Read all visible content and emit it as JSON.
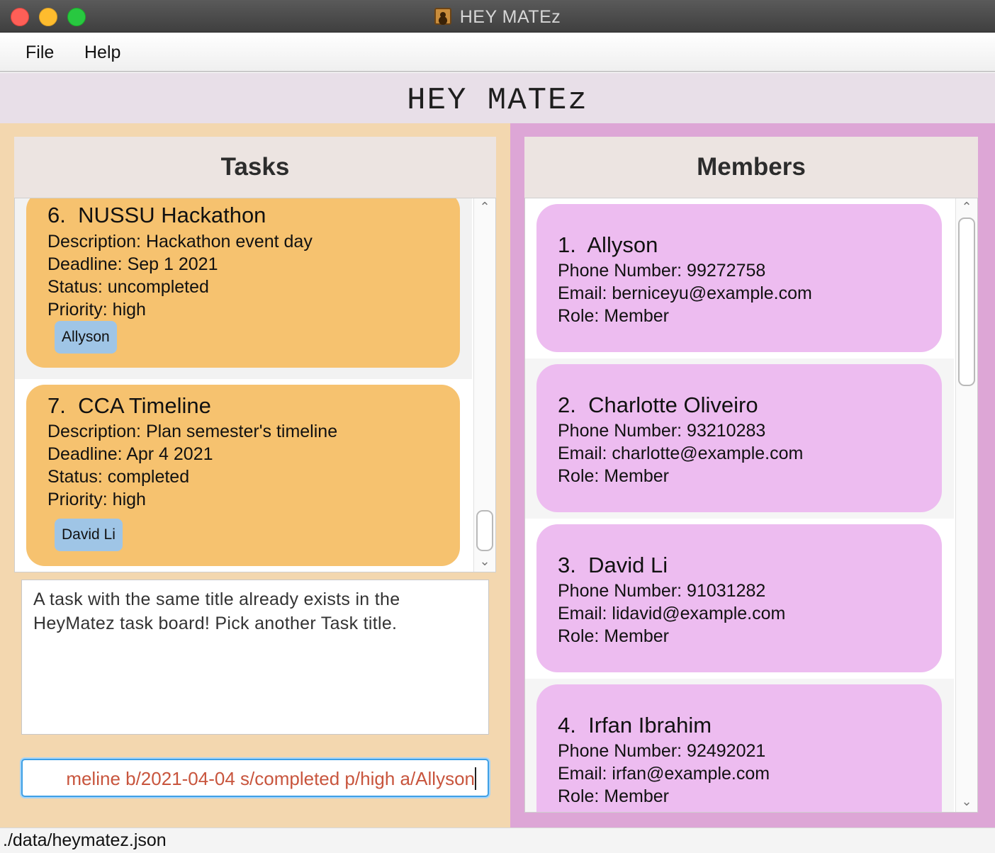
{
  "window": {
    "title": "HEY MATEz"
  },
  "menu": {
    "file": "File",
    "help": "Help"
  },
  "app": {
    "header_title": "HEY MATEz"
  },
  "tasks": {
    "header": "Tasks",
    "items": [
      {
        "index": "6.",
        "title": "NUSSU Hackathon",
        "description": "Description: Hackathon event day",
        "deadline": "Deadline: Sep 1 2021",
        "status": "Status: uncompleted",
        "priority": "Priority: high",
        "assignee": "Allyson"
      },
      {
        "index": "7.",
        "title": "CCA Timeline",
        "description": "Description: Plan semester's timeline",
        "deadline": "Deadline: Apr 4 2021",
        "status": "Status: completed",
        "priority": "Priority: high",
        "assignee": "David Li"
      }
    ]
  },
  "result": {
    "line1": "A task with the same title already exists in the",
    "line2": "HeyMatez task board! Pick another Task title."
  },
  "command": {
    "value": "meline b/2021-04-04 s/completed p/high a/Allyson"
  },
  "members": {
    "header": "Members",
    "items": [
      {
        "index": "1.",
        "name": "Allyson",
        "phone": "Phone Number: 99272758",
        "email": "Email: berniceyu@example.com",
        "role": "Role: Member"
      },
      {
        "index": "2.",
        "name": "Charlotte Oliveiro",
        "phone": "Phone Number: 93210283",
        "email": "Email: charlotte@example.com",
        "role": "Role: Member"
      },
      {
        "index": "3.",
        "name": "David Li",
        "phone": "Phone Number: 91031282",
        "email": "Email: lidavid@example.com",
        "role": "Role: Member"
      },
      {
        "index": "4.",
        "name": "Irfan Ibrahim",
        "phone": "Phone Number: 92492021",
        "email": "Email: irfan@example.com",
        "role": "Role: Member"
      }
    ]
  },
  "statusbar": {
    "path": "./data/heymatez.json"
  },
  "colors": {
    "task_card": "#f6c26f",
    "member_card": "#edbcf0",
    "tag": "#9fc5e6",
    "left_pane": "#f3d7af",
    "right_pane": "#dda6d6",
    "command_text": "#c8553d"
  }
}
